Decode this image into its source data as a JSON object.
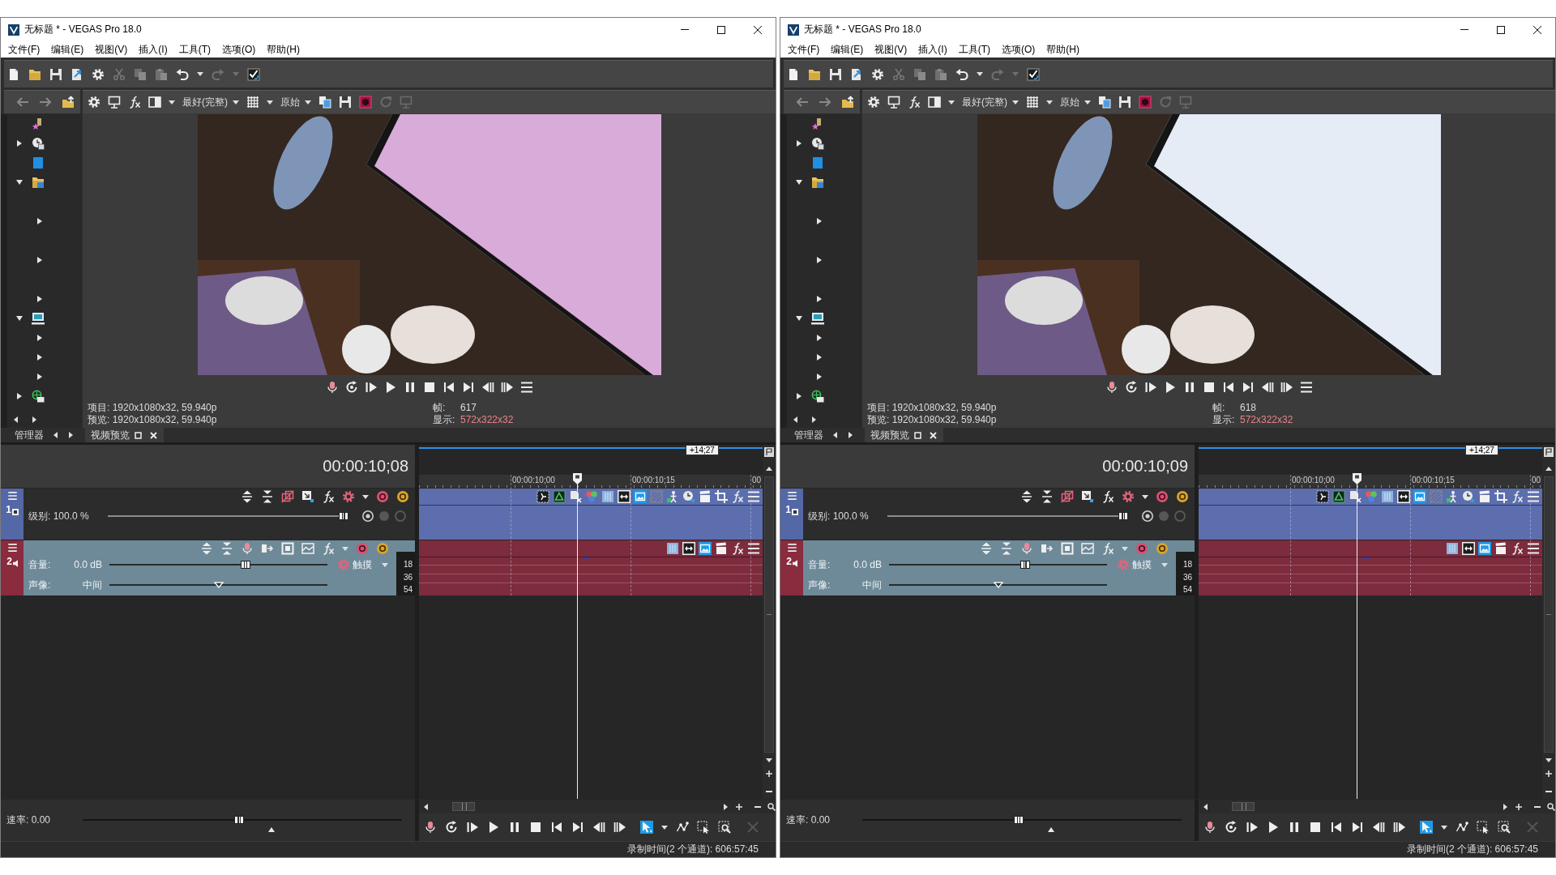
{
  "windows": [
    {
      "title": "无标题 * - VEGAS Pro 18.0",
      "menu": [
        "文件(F)",
        "编辑(E)",
        "视图(V)",
        "插入(I)",
        "工具(T)",
        "选项(O)",
        "帮助(H)"
      ],
      "explorer": {
        "tree": [
          {
            "kind": "star"
          },
          {
            "kind": "clock",
            "expanded": false
          },
          {
            "kind": "tile"
          },
          {
            "kind": "folder",
            "expanded": true,
            "children": [
              {
                "expanded": false
              },
              {
                "expanded": false
              },
              {
                "expanded": false
              }
            ]
          },
          {
            "kind": "computer",
            "expanded": true,
            "children": [
              {
                "expanded": false
              },
              {
                "expanded": false
              },
              {
                "expanded": false
              }
            ]
          },
          {
            "kind": "network",
            "expanded": false
          }
        ],
        "tab": "管理器"
      },
      "preview": {
        "quality": "最好(完整)",
        "size": "原始",
        "photo": {
          "color": "#d9abd9"
        },
        "info": [
          "项目: 1920x1080x32, 59.940p",
          "预览: 1920x1080x32, 59.940p"
        ],
        "frame_label": "帧:",
        "frame": "617",
        "display_label": "显示:",
        "display": "572x322x32",
        "tab": "视频预览"
      },
      "timeline": {
        "time": "00:00:10;08",
        "marker": "+14;27",
        "ruler": [
          "00:00:10;00",
          "00:00:10;15",
          "00"
        ],
        "tracks": [
          {
            "kind": "video",
            "number": "1",
            "sliders": [
              {
                "kind": "level",
                "label": "级别: 100.0 %",
                "level": 1
              }
            ],
            "event_buttons": [
              {
                "kind": "dotted-frame",
                "on": false
              },
              {
                "kind": "triangle",
                "on": false
              },
              {
                "kind": "document",
                "on": false
              },
              {
                "kind": "circles",
                "on": false
              },
              {
                "kind": "bars",
                "on": false
              },
              {
                "kind": "double-arrow",
                "on": false
              },
              {
                "kind": "image",
                "on": true
              },
              {
                "kind": "hatched",
                "on": false
              },
              {
                "kind": "figure",
                "on": false
              },
              {
                "kind": "clock",
                "on": false
              },
              {
                "kind": "clapboard",
                "on": false
              },
              {
                "kind": "crop",
                "on": false
              },
              {
                "kind": "fx",
                "on": false
              },
              {
                "kind": "menu",
                "on": false
              }
            ]
          },
          {
            "kind": "audio",
            "number": "2",
            "sliders": [
              {
                "kind": "volume",
                "label": "音量:",
                "value": "0.0 dB",
                "level": 0.63
              },
              {
                "kind": "pan",
                "label": "声像:",
                "value": "中间",
                "level": 0.5
              }
            ],
            "automation": "触摸",
            "meter": [
              "18",
              "36",
              "54"
            ],
            "event_buttons": [
              {
                "kind": "bars",
                "on": false
              },
              {
                "kind": "double-arrow",
                "on": false
              },
              {
                "kind": "image",
                "on": true
              },
              {
                "kind": "clapboard",
                "on": false
              },
              {
                "kind": "fx",
                "on": false
              },
              {
                "kind": "menu",
                "on": false
              }
            ]
          }
        ],
        "rate": {
          "label": "速率: 0.00",
          "level": 0.49
        },
        "tools": [
          {
            "kind": "edit",
            "selected": true
          },
          {
            "kind": "envelope",
            "selected": false
          },
          {
            "kind": "selection",
            "selected": false
          },
          {
            "kind": "zoom",
            "selected": false
          }
        ]
      },
      "status": "录制时间(2 个通道): 606:57:45"
    },
    {
      "title": "无标题 * - VEGAS Pro 18.0",
      "menu": [
        "文件(F)",
        "编辑(E)",
        "视图(V)",
        "插入(I)",
        "工具(T)",
        "选项(O)",
        "帮助(H)"
      ],
      "explorer": {
        "tree": [
          {
            "kind": "star"
          },
          {
            "kind": "clock",
            "expanded": false
          },
          {
            "kind": "tile"
          },
          {
            "kind": "folder",
            "expanded": true,
            "children": [
              {
                "expanded": false
              },
              {
                "expanded": false
              },
              {
                "expanded": false
              }
            ]
          },
          {
            "kind": "computer",
            "expanded": true,
            "children": [
              {
                "expanded": false
              },
              {
                "expanded": false
              },
              {
                "expanded": false
              }
            ]
          },
          {
            "kind": "network",
            "expanded": false
          }
        ],
        "tab": "管理器"
      },
      "preview": {
        "quality": "最好(完整)",
        "size": "原始",
        "photo": {
          "color": "#e5ecf6"
        },
        "info": [
          "项目: 1920x1080x32, 59.940p",
          "预览: 1920x1080x32, 59.940p"
        ],
        "frame_label": "帧:",
        "frame": "618",
        "display_label": "显示:",
        "display": "572x322x32",
        "tab": "视频预览"
      },
      "timeline": {
        "time": "00:00:10;09",
        "marker": "+14;27",
        "ruler": [
          "00:00:10;00",
          "00:00:10;15",
          "00"
        ],
        "tracks": [
          {
            "kind": "video",
            "number": "1",
            "sliders": [
              {
                "kind": "level",
                "label": "级别: 100.0 %",
                "level": 1
              }
            ],
            "event_buttons": [
              {
                "kind": "dotted-frame",
                "on": false
              },
              {
                "kind": "triangle",
                "on": false
              },
              {
                "kind": "document",
                "on": false
              },
              {
                "kind": "circles",
                "on": false
              },
              {
                "kind": "bars",
                "on": false
              },
              {
                "kind": "double-arrow",
                "on": false
              },
              {
                "kind": "image",
                "on": true
              },
              {
                "kind": "hatched",
                "on": false
              },
              {
                "kind": "figure",
                "on": false
              },
              {
                "kind": "clock",
                "on": false
              },
              {
                "kind": "clapboard",
                "on": false
              },
              {
                "kind": "crop",
                "on": false
              },
              {
                "kind": "fx",
                "on": false
              },
              {
                "kind": "menu",
                "on": false
              }
            ]
          },
          {
            "kind": "audio",
            "number": "2",
            "sliders": [
              {
                "kind": "volume",
                "label": "音量:",
                "value": "0.0 dB",
                "level": 0.63
              },
              {
                "kind": "pan",
                "label": "声像:",
                "value": "中间",
                "level": 0.5
              }
            ],
            "automation": "触摸",
            "meter": [
              "18",
              "36",
              "54"
            ],
            "event_buttons": [
              {
                "kind": "bars",
                "on": false
              },
              {
                "kind": "double-arrow",
                "on": false
              },
              {
                "kind": "image",
                "on": true
              },
              {
                "kind": "clapboard",
                "on": false
              },
              {
                "kind": "fx",
                "on": false
              },
              {
                "kind": "menu",
                "on": false
              }
            ]
          }
        ],
        "rate": {
          "label": "速率: 0.00",
          "level": 0.49
        },
        "tools": [
          {
            "kind": "edit",
            "selected": true
          },
          {
            "kind": "envelope",
            "selected": false
          },
          {
            "kind": "selection",
            "selected": false
          },
          {
            "kind": "zoom",
            "selected": false
          }
        ]
      },
      "status": "录制时间(2 个通道): 606:57:45"
    }
  ]
}
